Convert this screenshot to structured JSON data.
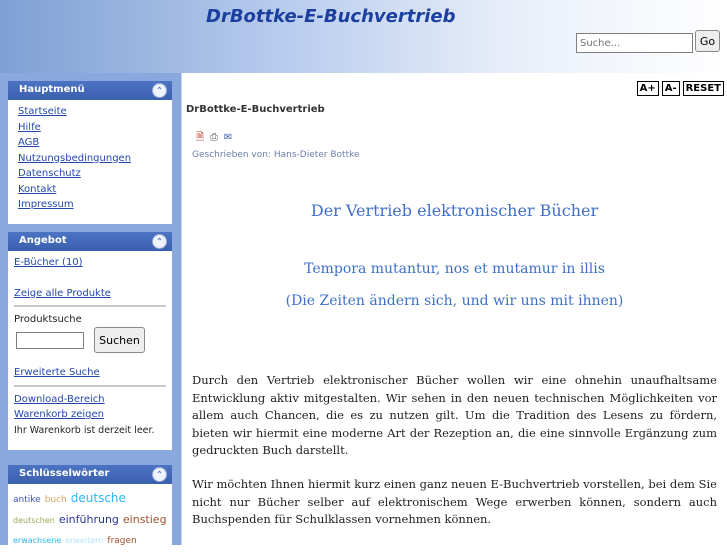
{
  "header": {
    "site_title": "DrBottke-E-Buchvertrieb",
    "search_placeholder": "Suche...",
    "search_button": "Go"
  },
  "sidebar": {
    "hauptmenu": {
      "title": "Hauptmenü",
      "items": [
        "Startseite",
        "Hilfe",
        "AGB",
        "Nutzungsbedingungen",
        "Datenschutz",
        "Kontakt",
        "Impressum"
      ]
    },
    "angebot": {
      "title": "Angebot",
      "ebooks": "E-Bücher (10)",
      "show_all": "Zeige alle Produkte",
      "product_search_label": "Produktsuche",
      "search_button": "Suchen",
      "advanced_search": "Erweiterte Suche",
      "download_area": "Download-Bereich",
      "show_cart": "Warenkorb zeigen",
      "cart_status": "Ihr Warenkorb ist derzeit leer."
    },
    "keywords": {
      "title": "Schlüsselwörter",
      "tags": [
        {
          "text": "antike",
          "color": "#3f51b5"
        },
        {
          "text": "buch",
          "color": "#e0a060"
        },
        {
          "text": "deutsche",
          "color": "#29b6f6"
        },
        {
          "text": "deutschen",
          "color": "#9ea55a"
        },
        {
          "text": "einführung",
          "color": "#283593"
        },
        {
          "text": "einstieg",
          "color": "#a0522d"
        },
        {
          "text": "erwachsene",
          "color": "#29b6f6"
        },
        {
          "text": "erweitern",
          "color": "#b3e5fc"
        },
        {
          "text": "fragen",
          "color": "#a0522d"
        }
      ]
    }
  },
  "toolbar": {
    "font_increase": "A+",
    "font_decrease": "A-",
    "font_reset": "RESET"
  },
  "article": {
    "title": "DrBottke-E-Buchvertrieb",
    "author": "Geschrieben von: Hans-Dieter Bottke",
    "heading": "Der Vertrieb elektronischer Bücher",
    "subheading1": "Tempora mutantur, nos et mutamur in illis",
    "subheading2": "(Die Zeiten ändern sich, und wir uns mit ihnen)",
    "paragraph1": "Durch den Vertrieb elektronischer Bücher wollen wir eine ohnehin unaufhaltsame Entwicklung aktiv mitgestalten. Wir sehen in den neuen technischen Möglichkeiten vor allem auch Chancen, die es zu nutzen gilt. Um die Tradition des Lesens zu fördern, bieten wir hiermit eine moderne Art der Rezeption an, die eine sinnvolle Ergänzung zum gedruckten Buch darstellt.",
    "paragraph2": "Wir möchten Ihnen hiermit kurz einen ganz neuen E-Buchvertrieb vorstellen, bei dem Sie nicht nur Bücher selber auf elektronischem Wege erwerben können, sondern auch Buchspenden für Schulklassen vornehmen können."
  }
}
